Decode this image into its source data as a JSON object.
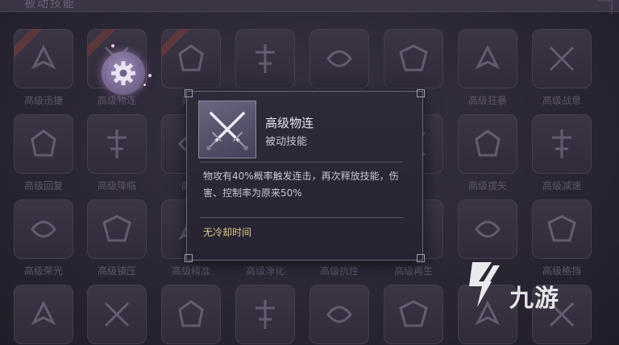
{
  "panel": {
    "title": "被动技能"
  },
  "skills": [
    {
      "label": "高级迅捷",
      "icon": "boot-icon",
      "ribbon": true
    },
    {
      "label": "高级物连",
      "icon": "crossed-swords-icon",
      "ribbon": true
    },
    {
      "label": "高级",
      "icon": "warrior-icon",
      "ribbon": true
    },
    {
      "label": "",
      "icon": "sword-shield-icon",
      "ribbon": false
    },
    {
      "label": "",
      "icon": "axe-icon",
      "ribbon": false
    },
    {
      "label": "",
      "icon": "demon-icon",
      "ribbon": false
    },
    {
      "label": "高级狂暴",
      "icon": "double-axe-icon",
      "ribbon": false
    },
    {
      "label": "高级战意",
      "icon": "wings-icon",
      "ribbon": false
    },
    {
      "label": "高级回复",
      "icon": "shield-icon",
      "ribbon": false
    },
    {
      "label": "高级降临",
      "icon": "skull-icon",
      "ribbon": false
    },
    {
      "label": "高级",
      "icon": "rune-icon",
      "ribbon": false
    },
    {
      "label": "",
      "icon": "helm-icon",
      "ribbon": false
    },
    {
      "label": "",
      "icon": "mask-icon",
      "ribbon": false
    },
    {
      "label": "击",
      "icon": "heart-icon",
      "ribbon": false
    },
    {
      "label": "高级拔矢",
      "icon": "crossbow-icon",
      "ribbon": false
    },
    {
      "label": "高级减速",
      "icon": "boot-icon",
      "ribbon": false
    },
    {
      "label": "高级荣光",
      "icon": "crest-icon",
      "ribbon": false
    },
    {
      "label": "高级镇压",
      "icon": "hammer-icon",
      "ribbon": false
    },
    {
      "label": "高级精准",
      "icon": "star-icon",
      "ribbon": false
    },
    {
      "label": "高级净化",
      "icon": "flame-icon",
      "ribbon": false
    },
    {
      "label": "高级抗性",
      "icon": "armor-icon",
      "ribbon": false
    },
    {
      "label": "高级再生",
      "icon": "leaf-icon",
      "ribbon": false
    },
    {
      "label": "",
      "icon": "clover-icon",
      "ribbon": false
    },
    {
      "label": "高级格挡",
      "icon": "cross-shield-icon",
      "ribbon": false
    },
    {
      "label": "",
      "icon": "crossed-blades-icon",
      "ribbon": false
    },
    {
      "label": "",
      "icon": "helmet-icon",
      "ribbon": false
    },
    {
      "label": "",
      "icon": "knight-icon",
      "ribbon": false
    },
    {
      "label": "",
      "icon": "heart-emblem-icon",
      "ribbon": false
    },
    {
      "label": "",
      "icon": "hood-icon",
      "ribbon": false
    },
    {
      "label": "",
      "icon": "tower-icon",
      "ribbon": false
    },
    {
      "label": "",
      "icon": "scales-icon",
      "ribbon": false
    },
    {
      "label": "",
      "icon": "ring-icon",
      "ribbon": false
    }
  ],
  "tooltip": {
    "name": "高级物连",
    "type": "被动技能",
    "description": "物攻有40%概率触发连击，再次释放技能，伤害、控制率为原来50%",
    "cooldown": "无冷却时间",
    "icon": "crossed-swords-icon"
  },
  "watermark": {
    "text": "九游",
    "logo": "nine-game-logo"
  },
  "colors": {
    "accent_gold": "#d9c990",
    "tooltip_bg": "#2b2735",
    "gear_glow": "#9e8db5"
  }
}
